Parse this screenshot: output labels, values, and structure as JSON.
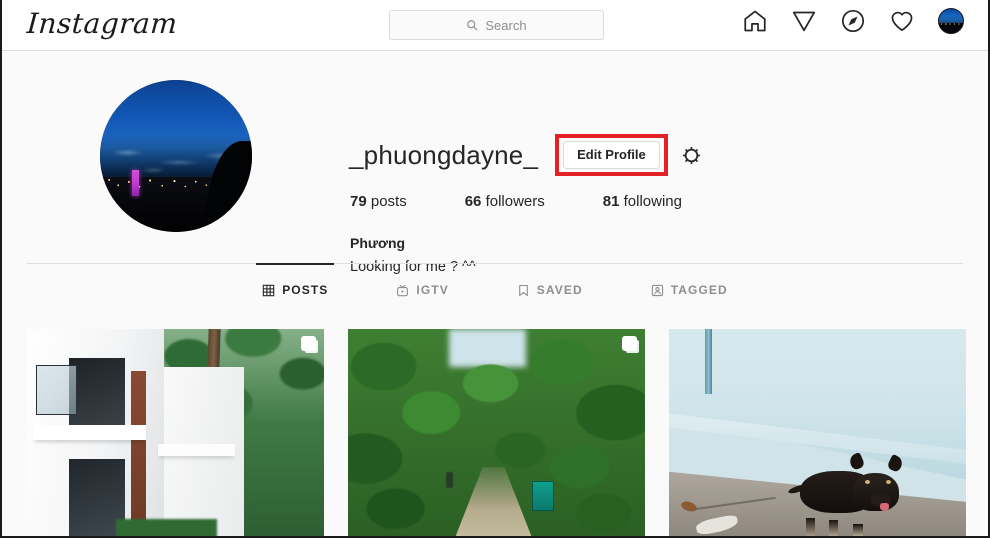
{
  "header": {
    "logo_text": "Instagram",
    "search": {
      "placeholder": "Search",
      "value": "",
      "icon": "search-icon"
    },
    "nav": [
      {
        "name": "home-icon",
        "label": "Home"
      },
      {
        "name": "direct-share-icon",
        "label": "Direct"
      },
      {
        "name": "explore-compass-icon",
        "label": "Explore"
      },
      {
        "name": "activity-heart-icon",
        "label": "Activity"
      },
      {
        "name": "profile-avatar",
        "label": "Profile"
      }
    ]
  },
  "profile": {
    "avatar_alt": "night cityscape profile photo",
    "username": "_phuongdayne_",
    "edit_button_label": "Edit Profile",
    "settings_icon": "gear-icon",
    "highlight_color": "#e32227",
    "stats": [
      {
        "count": "79",
        "label": "posts"
      },
      {
        "count": "66",
        "label": "followers"
      },
      {
        "count": "81",
        "label": "following"
      }
    ],
    "full_name": "Phương",
    "bio": "Looking for me ? ^^"
  },
  "tabs": [
    {
      "label": "POSTS",
      "icon": "grid-icon",
      "active": true
    },
    {
      "label": "IGTV",
      "icon": "igtv-icon",
      "active": false
    },
    {
      "label": "SAVED",
      "icon": "bookmark-icon",
      "active": false
    },
    {
      "label": "TAGGED",
      "icon": "tagged-person-icon",
      "active": false
    }
  ],
  "grid": [
    {
      "alt": "white modern building with balconies and trees",
      "multi": true
    },
    {
      "alt": "green forest path with teal container",
      "multi": true
    },
    {
      "alt": "black dog beside light blue wall",
      "multi": false
    }
  ]
}
